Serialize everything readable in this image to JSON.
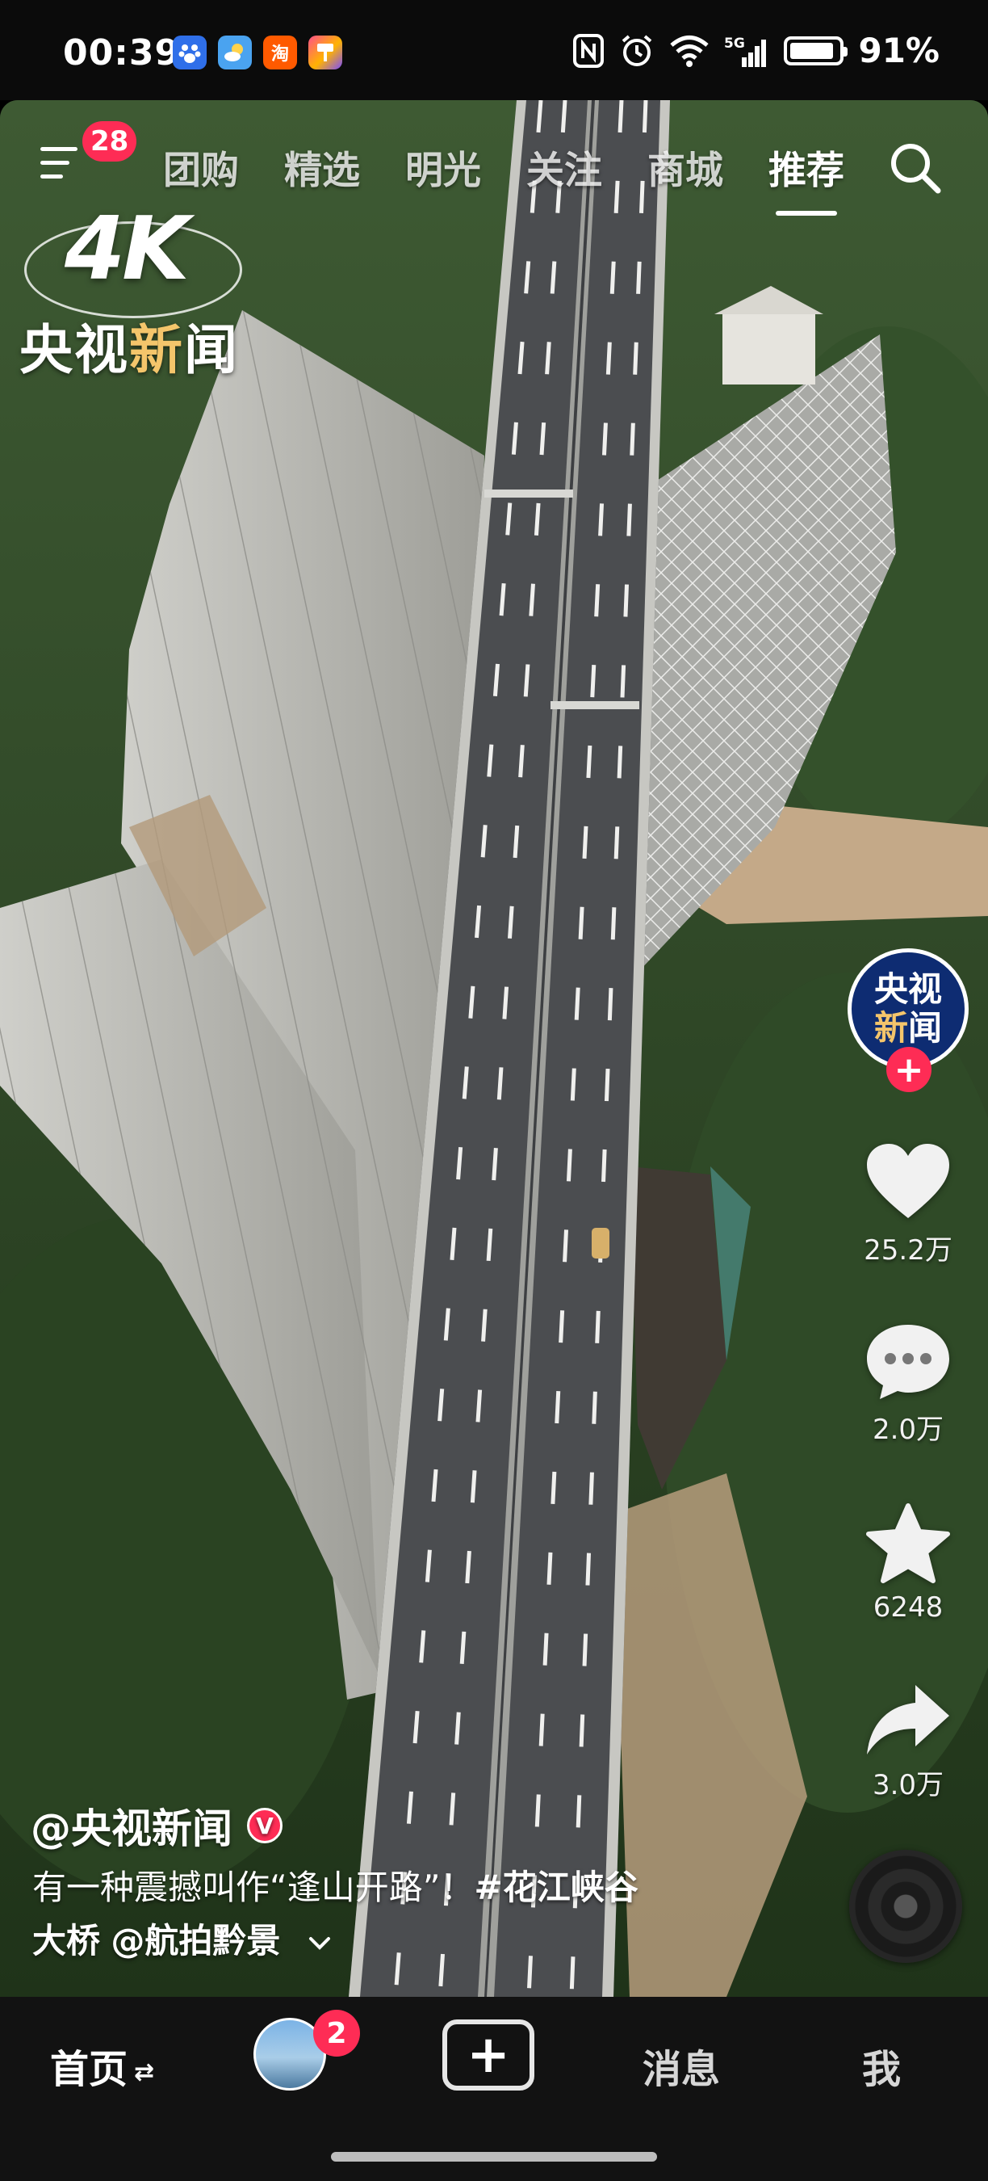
{
  "status_bar": {
    "time": "00:39",
    "notification_icons": [
      "baidu-icon",
      "weather-icon",
      "taobao-icon",
      "paint-icon"
    ],
    "taobao_glyph": "淘",
    "network": "5G",
    "battery_percent": "91%",
    "battery_level": 0.91
  },
  "top_nav": {
    "menu_badge": "28",
    "tabs": [
      "团购",
      "精选",
      "明光",
      "关注",
      "商城",
      "推荐"
    ],
    "active_tab": "推荐"
  },
  "watermark": {
    "quality": "4K",
    "channel_part1": "央视",
    "channel_part2": "新",
    "channel_part3": "闻"
  },
  "creator": {
    "avatar_line1": "央视",
    "avatar_line2_a": "新",
    "avatar_line2_b": "闻",
    "follow_symbol": "+"
  },
  "actions": {
    "likes": "25.2万",
    "comments": "2.0万",
    "favorites": "6248",
    "shares": "3.0万"
  },
  "caption": {
    "author": "@央视新闻",
    "verified_mark": "V",
    "text": "有一种震撼叫作“逢山开路”！",
    "hashtag": "#花江峡谷",
    "hashtag_cont": "大桥",
    "mention": "@航拍黔景"
  },
  "bottom_nav": {
    "home": "首页",
    "home_swap": "⇄",
    "friend_badge": "2",
    "add_symbol": "+",
    "messages": "消息",
    "me": "我"
  },
  "colors": {
    "accent": "#fe2c55",
    "brand_gold": "#f4c56b",
    "avatar_navy": "#0e2c72",
    "nav_bg": "#121212"
  }
}
